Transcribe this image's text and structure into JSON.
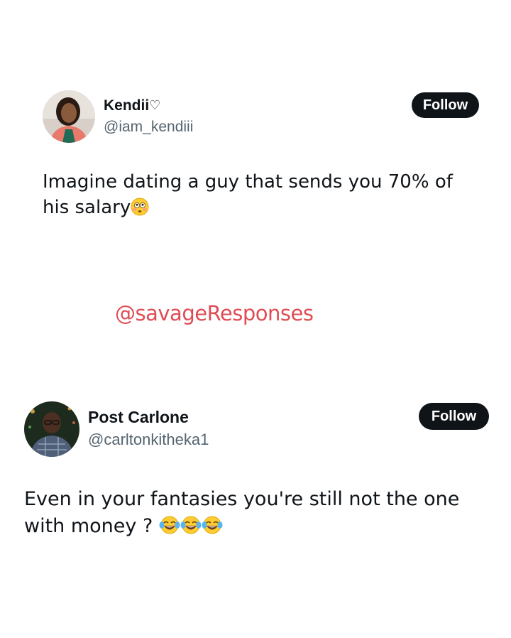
{
  "tweet1": {
    "name": "Kendii",
    "name_suffix": "♡",
    "handle": "@iam_kendiii",
    "follow_label": "Follow",
    "text": "Imagine dating a guy that sends you 70% of his salary",
    "emoji": "flushed-face-icon"
  },
  "watermark": "@savageResponses",
  "tweet2": {
    "name": "Post Carlone",
    "handle": "@carltonkitheka1",
    "follow_label": "Follow",
    "text": "Even in your fantasies you're still not the one with money ?",
    "emoji": [
      "tears-of-joy-icon",
      "tears-of-joy-icon",
      "tears-of-joy-icon"
    ]
  },
  "colors": {
    "text": "#0f1419",
    "handle": "#536471",
    "button": "#0f1419",
    "watermark": "#e04c55"
  }
}
